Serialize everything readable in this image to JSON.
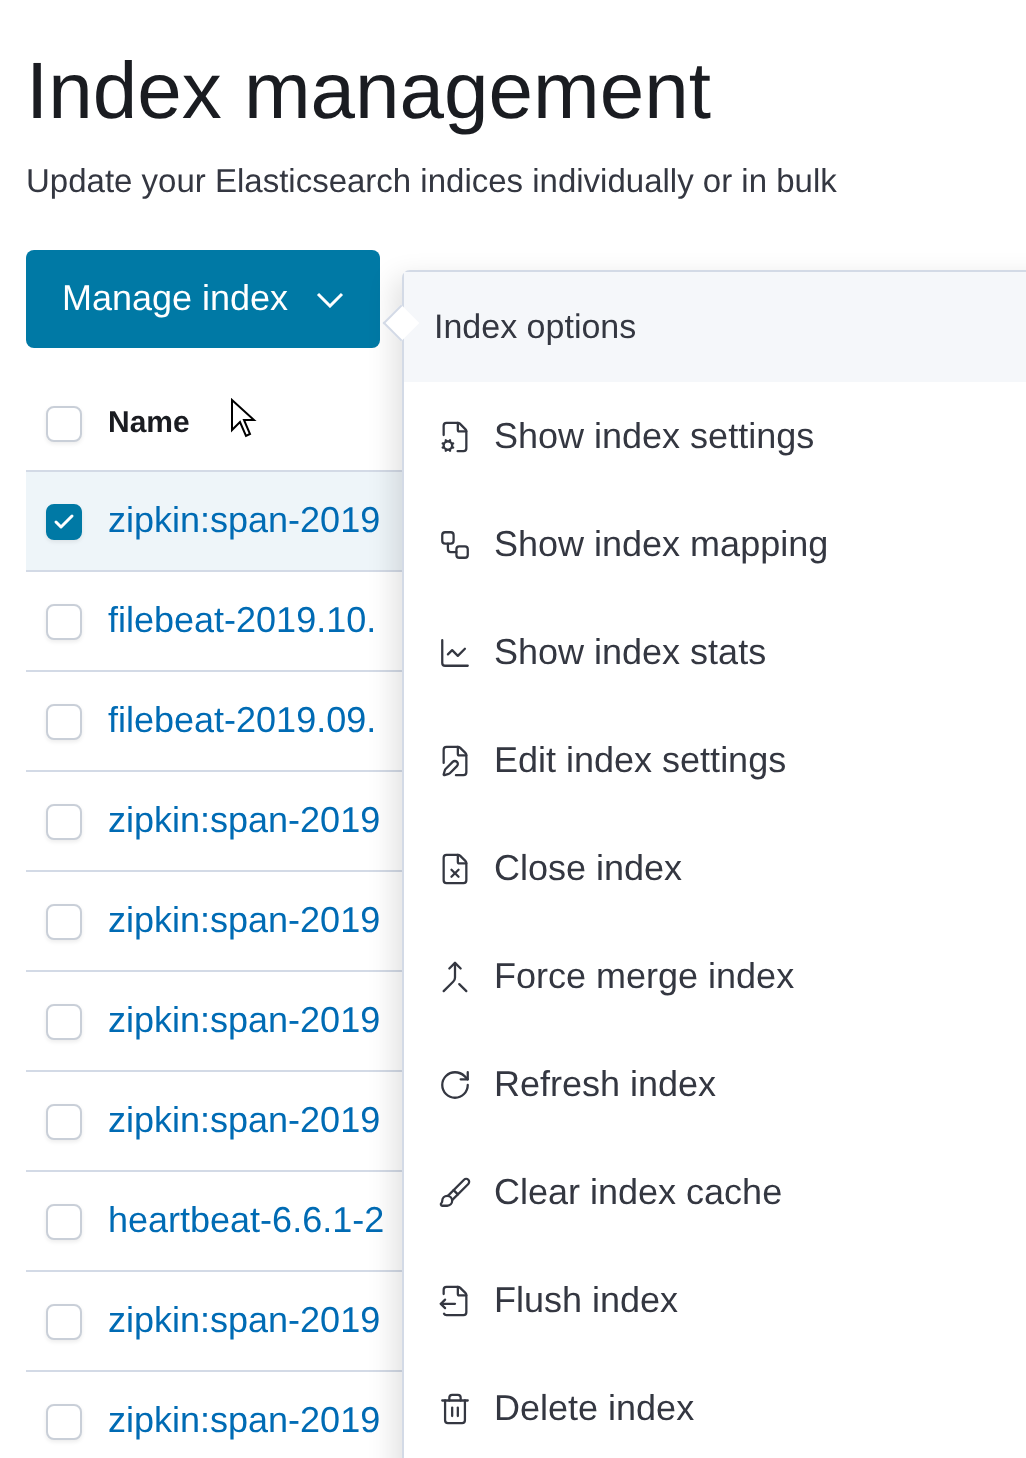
{
  "page": {
    "title": "Index management",
    "subtitle": "Update your Elasticsearch indices individually or in bulk"
  },
  "manage_button": {
    "label": "Manage index",
    "expanded": true
  },
  "table": {
    "columns": [
      "Name"
    ],
    "header_checked": false,
    "rows": [
      {
        "name": "zipkin:span-2019",
        "selected": true
      },
      {
        "name": "filebeat-2019.10.",
        "selected": false
      },
      {
        "name": "filebeat-2019.09.",
        "selected": false
      },
      {
        "name": "zipkin:span-2019",
        "selected": false
      },
      {
        "name": "zipkin:span-2019",
        "selected": false
      },
      {
        "name": "zipkin:span-2019",
        "selected": false
      },
      {
        "name": "zipkin:span-2019",
        "selected": false
      },
      {
        "name": "heartbeat-6.6.1-2",
        "selected": false
      },
      {
        "name": "zipkin:span-2019",
        "selected": false
      },
      {
        "name": "zipkin:span-2019",
        "selected": false
      }
    ]
  },
  "popover": {
    "title": "Index options",
    "items": [
      {
        "label": "Show index settings",
        "kind": "settings"
      },
      {
        "label": "Show index mapping",
        "kind": "mapping"
      },
      {
        "label": "Show index stats",
        "kind": "stats"
      },
      {
        "label": "Edit index settings",
        "kind": "edit"
      },
      {
        "label": "Close index",
        "kind": "close"
      },
      {
        "label": "Force merge index",
        "kind": "merge"
      },
      {
        "label": "Refresh index",
        "kind": "refresh"
      },
      {
        "label": "Clear index cache",
        "kind": "clear"
      },
      {
        "label": "Flush index",
        "kind": "flush"
      },
      {
        "label": "Delete index",
        "kind": "delete"
      }
    ]
  }
}
